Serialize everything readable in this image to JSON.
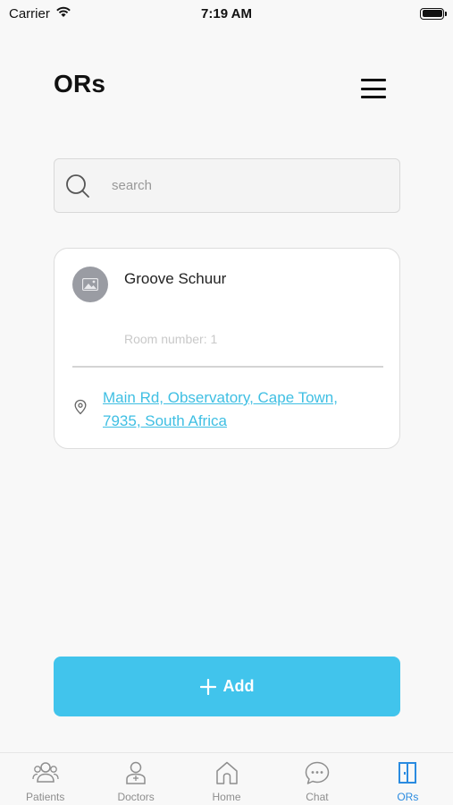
{
  "status_bar": {
    "carrier": "Carrier",
    "time": "7:19 AM"
  },
  "header": {
    "title": "ORs"
  },
  "search": {
    "placeholder": "search"
  },
  "or_card": {
    "name": "Groove Schuur",
    "room_number": "Room number: 1",
    "address": "Main Rd, Observatory, Cape Town, 7935, South Africa"
  },
  "add_button": {
    "label": "Add"
  },
  "tab_bar": {
    "tabs": [
      {
        "label": "Patients",
        "icon": "patients-icon"
      },
      {
        "label": "Doctors",
        "icon": "doctor-icon"
      },
      {
        "label": "Home",
        "icon": "home-icon"
      },
      {
        "label": "Chat",
        "icon": "chat-icon"
      },
      {
        "label": "ORs",
        "icon": "door-icon",
        "active": true
      }
    ]
  },
  "colors": {
    "accent": "#41c4ec",
    "link": "#3fbfe3",
    "active_tab": "#2a8be0",
    "inactive_tab": "#8e8e8e"
  }
}
